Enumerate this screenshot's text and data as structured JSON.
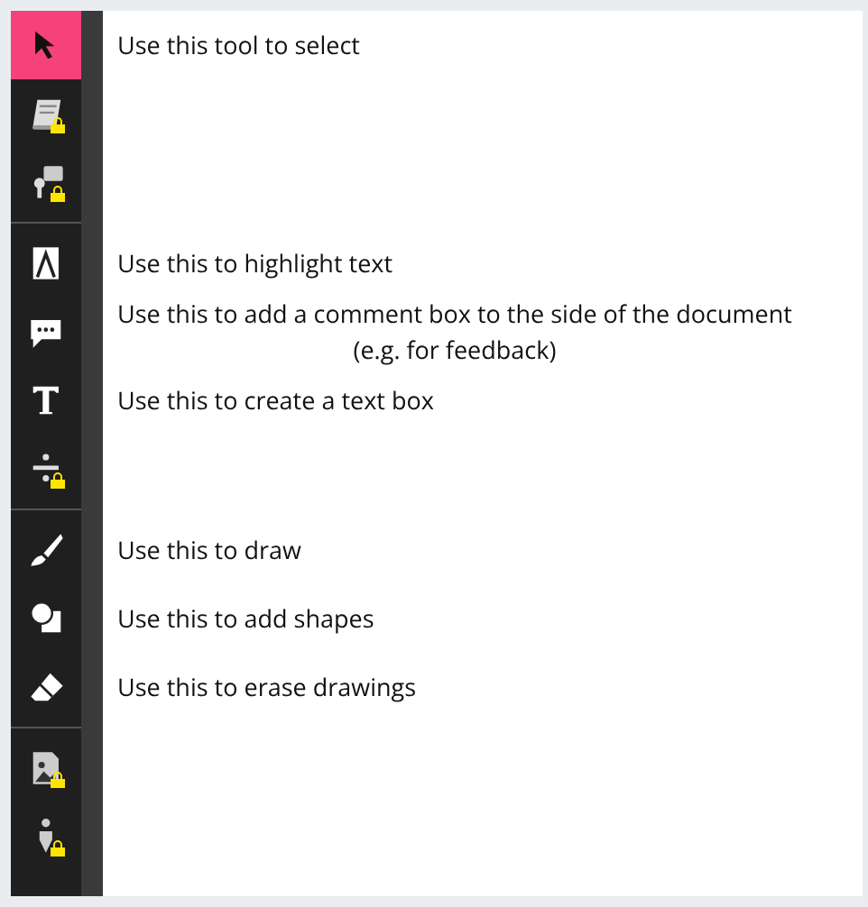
{
  "tool_groups": [
    {
      "tools": [
        {
          "kind": "cursor",
          "selected": true,
          "locked": false,
          "description": [
            "Use this tool to select"
          ]
        },
        {
          "kind": "book",
          "selected": false,
          "locked": true
        },
        {
          "kind": "speaker",
          "selected": false,
          "locked": true
        }
      ]
    },
    {
      "tools": [
        {
          "kind": "highlight",
          "selected": false,
          "locked": false,
          "description": [
            "Use this to highlight text"
          ]
        },
        {
          "kind": "comment",
          "selected": false,
          "locked": false,
          "description": [
            "Use this to add a comment box to the side of the document",
            "(e.g. for feedback)"
          ]
        },
        {
          "kind": "text",
          "selected": false,
          "locked": false,
          "description": [
            "Use this to create a text box"
          ]
        },
        {
          "kind": "divide",
          "selected": false,
          "locked": true
        }
      ]
    },
    {
      "tools": [
        {
          "kind": "brush",
          "selected": false,
          "locked": false,
          "description": [
            "Use this to draw"
          ]
        },
        {
          "kind": "shapes",
          "selected": false,
          "locked": false,
          "description": [
            "Use this to add shapes"
          ]
        },
        {
          "kind": "eraser",
          "selected": false,
          "locked": false,
          "description": [
            "Use this to erase drawings"
          ]
        }
      ]
    },
    {
      "tools": [
        {
          "kind": "image",
          "selected": false,
          "locked": true
        },
        {
          "kind": "pen",
          "selected": false,
          "locked": true
        }
      ]
    }
  ]
}
